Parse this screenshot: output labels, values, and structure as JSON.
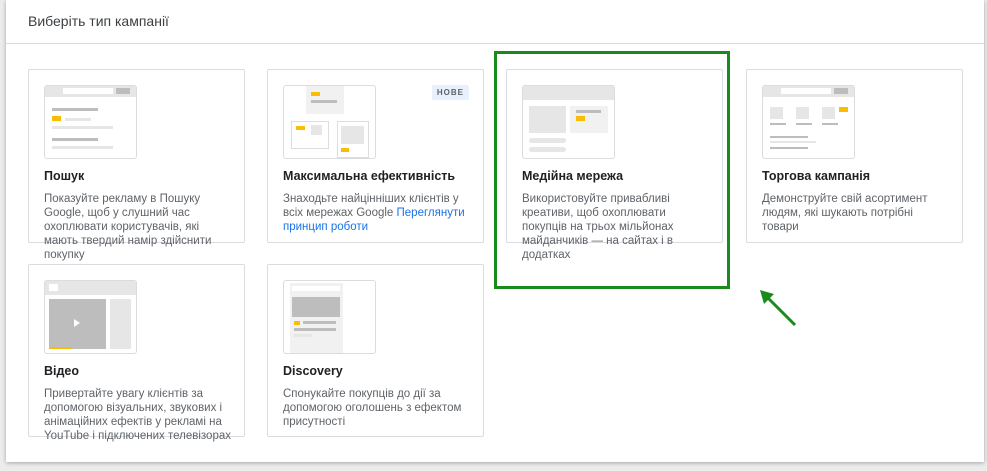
{
  "header": {
    "title": "Виберіть тип кампанії"
  },
  "cards": [
    {
      "title": "Пошук",
      "description": "Показуйте рекламу в Пошуку Google, щоб у слушний час охоплювати користувачів, які мають твердий намір здійснити покупку"
    },
    {
      "title": "Максимальна ефективність",
      "badge": "НОВЕ",
      "description": "Знаходьте найцінніших клієнтів у всіх мережах Google",
      "link": "Переглянути принцип роботи"
    },
    {
      "title": "Медійна мережа",
      "description": "Використовуйте привабливі креативи, щоб охоплювати покупців на трьох мільйонах майданчиків — на сайтах і в додатках",
      "selected": true
    },
    {
      "title": "Торгова кампанія",
      "description": "Демонструйте свій асортимент людям, які шукають потрібні товари"
    },
    {
      "title": "Відео",
      "description": "Привертайте увагу клієнтів за допомогою візуальних, звукових і анімаційних ефектів у рекламі на YouTube і підключених телевізорах"
    },
    {
      "title": "Discovery",
      "description": "Спонукайте покупців до дії за допомогою оголошень з ефектом присутності"
    }
  ],
  "colors": {
    "highlight": "#1a8a1a",
    "accent": "#fbbc04",
    "link": "#1a73e8"
  }
}
